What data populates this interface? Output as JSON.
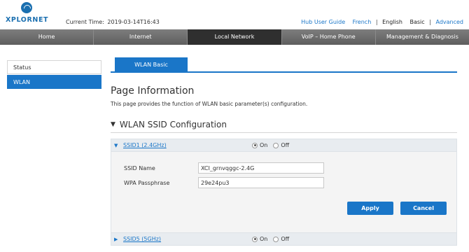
{
  "header": {
    "logo_text": "XPLORNET",
    "current_time_label": "Current Time:",
    "current_time_value": "2019-03-14T16:43",
    "links": {
      "hub_user_guide": "Hub User Guide",
      "french": "French",
      "english": "English",
      "basic": "Basic",
      "advanced": "Advanced",
      "separator": "|"
    }
  },
  "mainnav": {
    "tabs": [
      {
        "label": "Home"
      },
      {
        "label": "Internet"
      },
      {
        "label": "Local Network"
      },
      {
        "label": "VoIP – Home Phone"
      },
      {
        "label": "Management & Diagnosis"
      }
    ]
  },
  "sidebar": {
    "items": [
      {
        "label": "Status"
      },
      {
        "label": "WLAN"
      }
    ]
  },
  "content": {
    "subtab": "WLAN Basic",
    "page_title": "Page Information",
    "page_desc": "This page provides the function of WLAN basic parameter(s) configuration.",
    "section_title": "WLAN SSID Configuration",
    "section_arrow": "▼",
    "ssid1": {
      "name": "SSID1 (2.4GHz)",
      "on_label": "On",
      "off_label": "Off",
      "fields": {
        "ssid_name_label": "SSID Name",
        "ssid_name_value": "XCI_grnvqggc-2.4G",
        "wpa_label": "WPA Passphrase",
        "wpa_value": "29e24pu3"
      },
      "apply_label": "Apply",
      "cancel_label": "Cancel"
    },
    "ssid5": {
      "name": "SSID5 (5GHz)",
      "on_label": "On",
      "off_label": "Off"
    }
  },
  "colors": {
    "accent": "#1a76c8",
    "nav_bg": "#6e6e6e",
    "nav_active": "#2f2f2f"
  }
}
